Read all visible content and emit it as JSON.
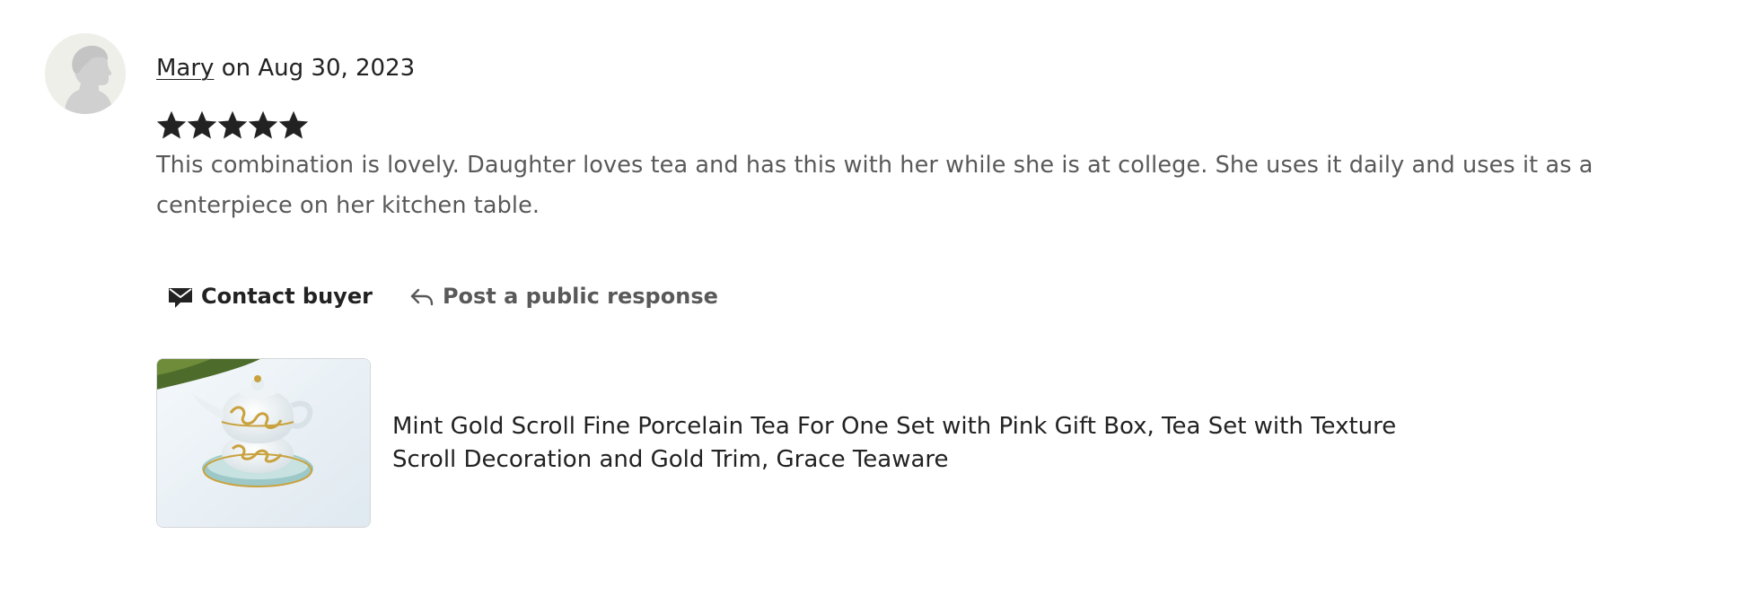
{
  "review": {
    "reviewer_name": "Mary",
    "date_text": " on Aug 30, 2023",
    "rating": 5,
    "rating_max": 5,
    "text": "This combination is lovely. Daughter loves tea and has this with her while she is at college. She uses it daily and uses it as a centerpiece on her kitchen table."
  },
  "actions": {
    "contact_label": "Contact buyer",
    "contact_icon": "envelope-icon",
    "respond_label": "Post a public response",
    "respond_icon": "reply-arrow-icon"
  },
  "listing": {
    "title": "Mint Gold Scroll Fine Porcelain Tea For One Set with Pink Gift Box, Tea Set with Texture Scroll Decoration and Gold Trim, Grace Teaware",
    "thumbnail": "teapot-thumbnail"
  },
  "colors": {
    "text_primary": "#222222",
    "text_secondary": "#595959",
    "star": "#222222",
    "avatar_bg": "#efefea",
    "avatar_silhouette": "#d0d0d0"
  }
}
